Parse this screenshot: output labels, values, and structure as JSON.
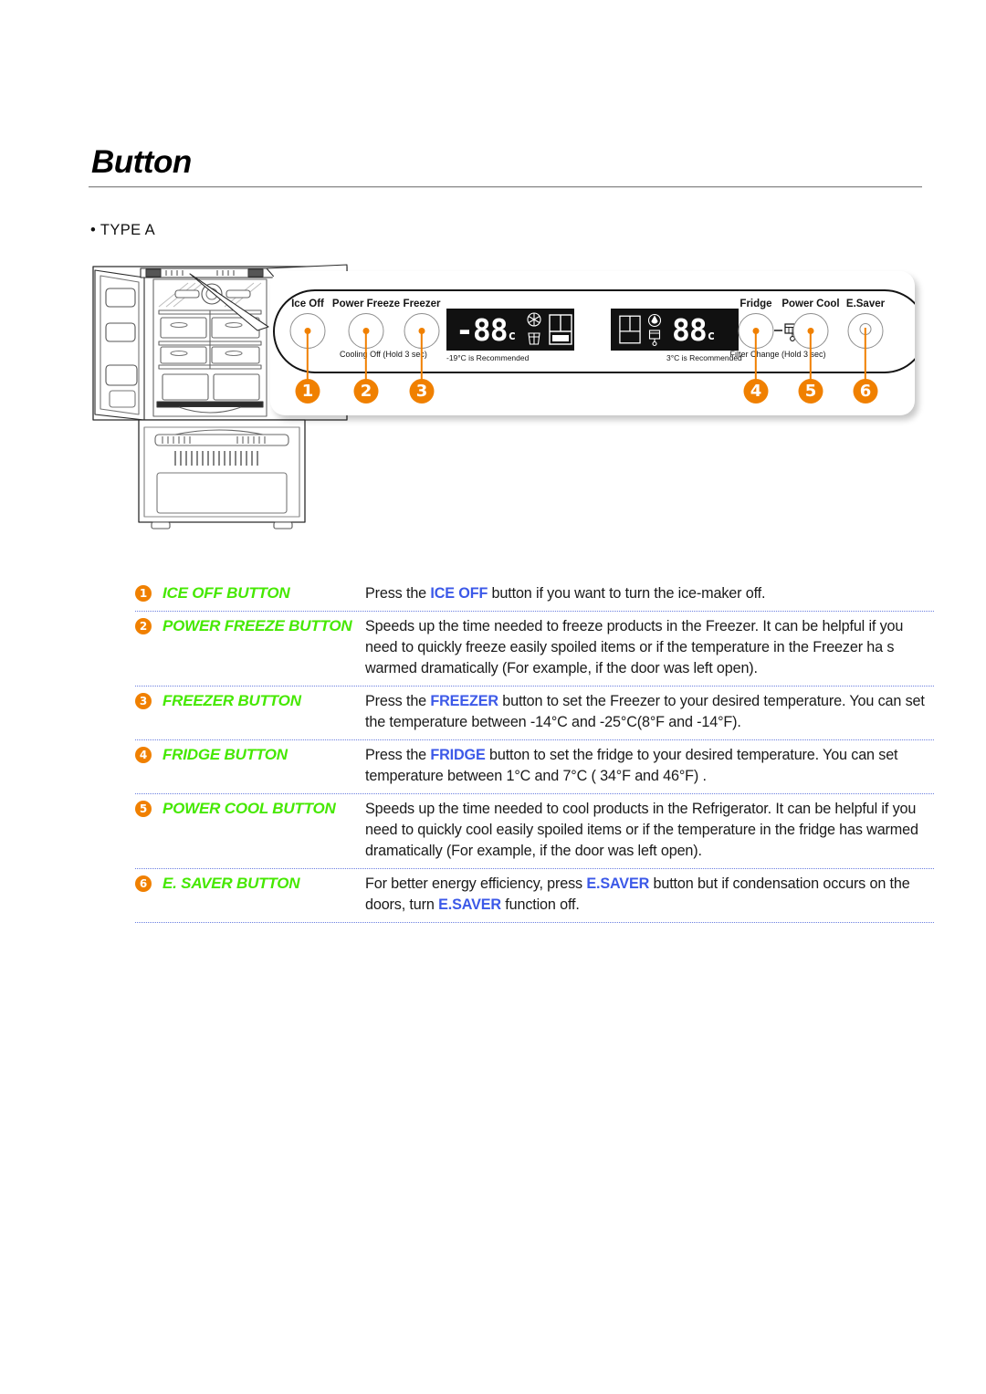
{
  "page": {
    "title": "Button",
    "type_label": "• TYPE A"
  },
  "panel": {
    "buttons": [
      {
        "label": "Ice Off",
        "caption": "",
        "indicator": "dot",
        "number": "1"
      },
      {
        "label": "Power Freeze",
        "caption": "Cooling Off (Hold 3 sec)",
        "indicator": "dot",
        "number": "2"
      },
      {
        "label": "Freezer",
        "caption": "",
        "indicator": "dot",
        "number": "3"
      },
      {
        "label": "Fridge",
        "caption": "Filter Change (Hold 3 sec)",
        "indicator": "dot",
        "number": "4"
      },
      {
        "label": "Power Cool",
        "caption": "",
        "indicator": "dot",
        "number": "5"
      },
      {
        "label": "E.Saver",
        "caption": "",
        "indicator": "ring",
        "number": "6"
      }
    ],
    "displays": [
      {
        "name": "freezer-display",
        "value": "-88",
        "unit": "c",
        "icons": [
          "snowflake-icon",
          "ice-cube-icon",
          "door-diagram-icon"
        ],
        "caption": "-19°C is Recommended"
      },
      {
        "name": "fridge-display",
        "value": "88",
        "unit": "c",
        "icons": [
          "door-diagram-icon",
          "water-filter-icon"
        ],
        "caption": "3°C is Recommended"
      }
    ],
    "filter_change_caption": "Filter Change (Hold 3 sec)",
    "cooling_off_caption": "Cooling Off (Hold 3 sec)"
  },
  "colors": {
    "accent_orange": "#F08000",
    "label_green": "#45E800",
    "keyword_blue": "#3C59E8",
    "separator_blue": "#6B7FE0"
  },
  "table": {
    "rows": [
      {
        "number": "1",
        "name": "ICE OFF BUTTON",
        "desc_parts": [
          {
            "t": "Press the ",
            "kw": false
          },
          {
            "t": "ICE OFF",
            "kw": true
          },
          {
            "t": " button if you want to turn the ice-maker off.",
            "kw": false
          }
        ]
      },
      {
        "number": "2",
        "name": "POWER FREEZE BUTTON",
        "desc_parts": [
          {
            "t": "Speeds up the time needed to freeze products in the Freezer. It can be helpful if you need to quickly freeze easily spoiled items or if the temperature in the Freezer ha s warmed dramatically (For example, if the door was left open).",
            "kw": false
          }
        ]
      },
      {
        "number": "3",
        "name": "FREEZER BUTTON",
        "desc_parts": [
          {
            "t": "Press the ",
            "kw": false
          },
          {
            "t": "FREEZER",
            "kw": true
          },
          {
            "t": " button to set the Freezer to your desired temperature. You can set the temperature between -14°C and -25°C(8°F and -14°F).",
            "kw": false
          }
        ]
      },
      {
        "number": "4",
        "name": "FRIDGE BUTTON",
        "desc_parts": [
          {
            "t": "Press the ",
            "kw": false
          },
          {
            "t": "FRIDGE",
            "kw": true
          },
          {
            "t": " button to set the fridge to your desired temperature. You can set temperature between 1°C and 7°C ( 34°F and 46°F) .",
            "kw": false
          }
        ]
      },
      {
        "number": "5",
        "name": "POWER COOL BUTTON",
        "desc_parts": [
          {
            "t": "Speeds up the time needed to cool products in the Refrigerator. It can be helpful if you need to quickly cool easily spoiled items or if the temperature in the fridge has warmed dramatically (For example, if the door was left open).",
            "kw": false
          }
        ]
      },
      {
        "number": "6",
        "name": "E. SAVER BUTTON",
        "desc_parts": [
          {
            "t": "For better energy efficiency, press ",
            "kw": false
          },
          {
            "t": "E.SAVER",
            "kw": true
          },
          {
            "t": " button but if condensation occurs on the doors, turn ",
            "kw": false
          },
          {
            "t": "E.SAVER",
            "kw": true
          },
          {
            "t": " function off.",
            "kw": false
          }
        ]
      }
    ]
  }
}
